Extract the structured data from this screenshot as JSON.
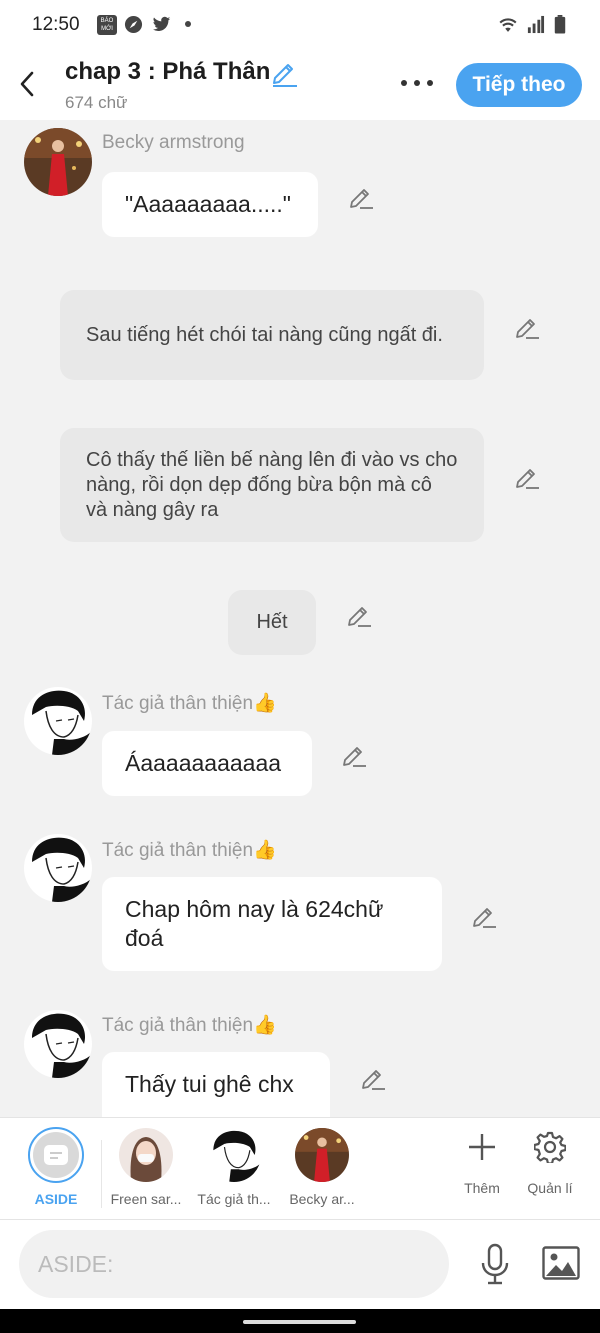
{
  "status_bar": {
    "time": "12:50",
    "notif_badge": "BÁO MỚI"
  },
  "header": {
    "title": "chap 3 : Phá Thân",
    "word_count": "674 chữ",
    "next_label": "Tiếp theo"
  },
  "messages": [
    {
      "sender": "Becky armstrong",
      "text": "\"Aaaaaaaaa.....\""
    },
    {
      "text": "Sau tiếng hét chói tai nàng cũng ngất đi."
    },
    {
      "text": "Cô thấy thế liền bế nàng lên đi vào vs cho nàng, rồi dọn dẹp đống bừa bộn mà cô và nàng gây ra"
    },
    {
      "text": "Hết"
    },
    {
      "sender": "Tác giả thân thiện👍",
      "text": "Áaaaaaaaaaaa"
    },
    {
      "sender": "Tác giả thân thiện👍",
      "text": "Chap hôm nay là 624chữ đoá"
    },
    {
      "sender": "Tác giả thân thiện👍",
      "text": "Thấy tui ghê chx"
    }
  ],
  "characters": [
    {
      "label": "ASIDE"
    },
    {
      "label": "Freen sar..."
    },
    {
      "label": "Tác giả th..."
    },
    {
      "label": "Becky ar..."
    }
  ],
  "actions": {
    "add_label": "Thêm",
    "manage_label": "Quản lí"
  },
  "composer": {
    "placeholder": "ASIDE:"
  },
  "colors": {
    "accent": "#4aa3f0",
    "background": "#f2f2f2",
    "narration_bubble": "#e8e8e8"
  }
}
